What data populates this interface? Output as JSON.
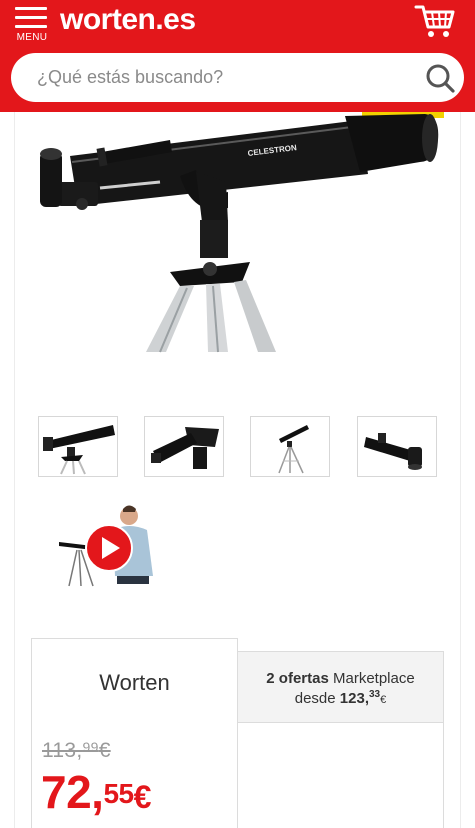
{
  "header": {
    "menu_label": "MENU",
    "logo_text": "worten.es",
    "cart_icon": "cart-icon",
    "menu_icon": "hamburger-icon",
    "brand_color": "#e3171b"
  },
  "search": {
    "placeholder": "¿Qué estás buscando?",
    "value": "",
    "icon": "search-icon"
  },
  "gallery": {
    "main_image": "telescope-refractor-on-tripod",
    "brand_on_tube": "CELESTRON",
    "thumbnails": [
      {
        "name": "telescope-side-view"
      },
      {
        "name": "telescope-lens-closeup"
      },
      {
        "name": "telescope-full-tripod"
      },
      {
        "name": "telescope-eyepiece-detail"
      }
    ],
    "video": {
      "icon": "play-icon"
    }
  },
  "offers": {
    "worten_tab": "Worten",
    "marketplace_count": "2 ofertas",
    "marketplace_label": "Marketplace",
    "from_label": "desde",
    "marketplace_price_int": "123,",
    "marketplace_price_cents": "33",
    "marketplace_price_cur": "€",
    "old_price_int": "113,",
    "old_price_cents": "99",
    "old_price_cur": "€",
    "price_int": "72,",
    "price_cents": "55",
    "price_cur": "€"
  }
}
